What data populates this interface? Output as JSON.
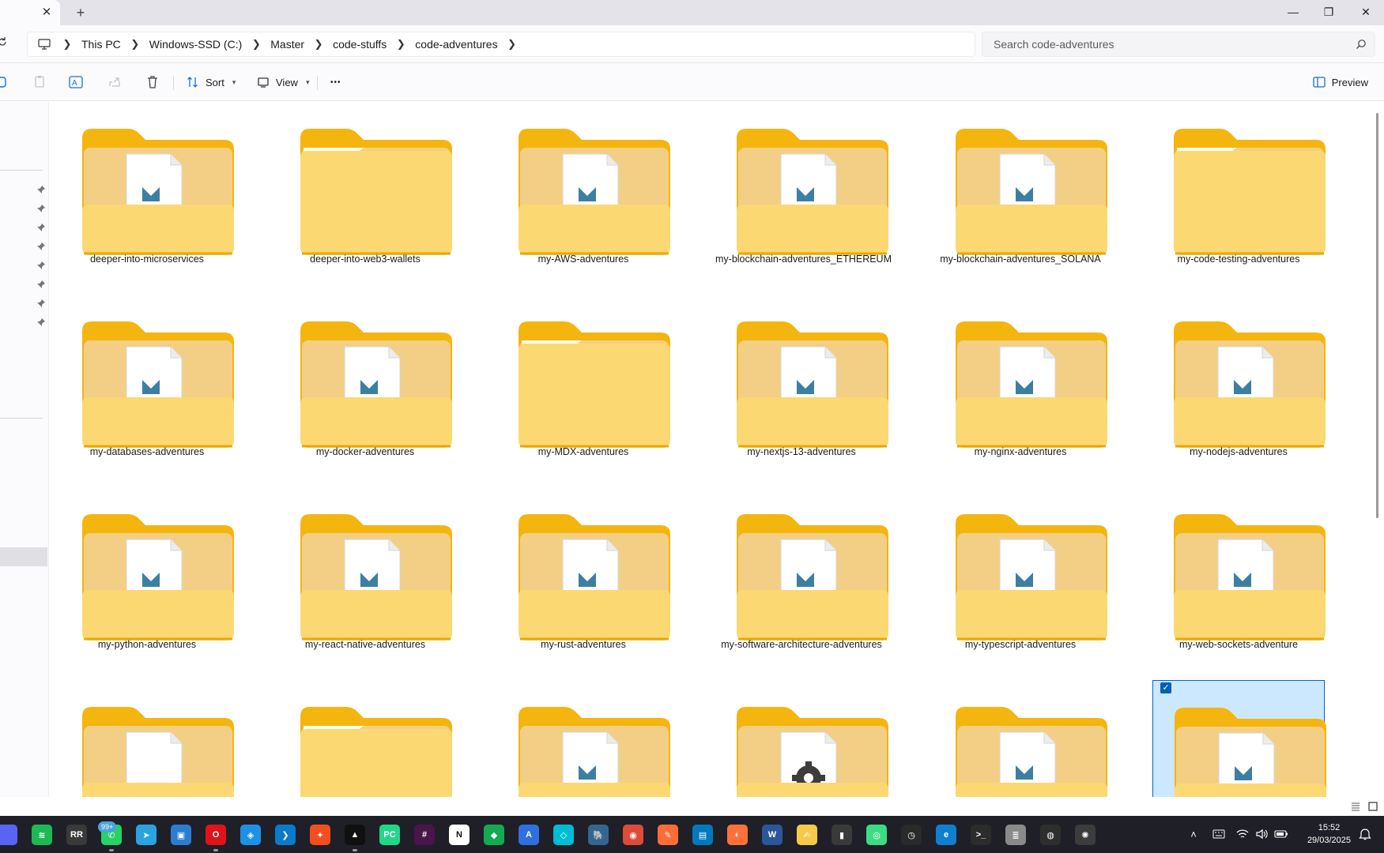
{
  "tabs": {
    "close_glyph": "✕",
    "new_tab_glyph": "+"
  },
  "window_controls": {
    "minimize": "—",
    "maximize": "❐",
    "close": "✕"
  },
  "breadcrumb": [
    "This PC",
    "Windows-SSD (C:)",
    "Master",
    "code-stuffs",
    "code-adventures"
  ],
  "search": {
    "placeholder": "Search code-adventures"
  },
  "toolbar": {
    "sort_label": "Sort",
    "view_label": "View",
    "more_glyph": "•••",
    "preview_label": "Preview",
    "icons": [
      "new-icon",
      "copy-icon",
      "rename-icon",
      "share-icon",
      "delete-icon"
    ]
  },
  "folders": [
    {
      "name": "deeper-into-microservices",
      "overlay": "markdown"
    },
    {
      "name": "deeper-into-web3-wallets",
      "overlay": "none"
    },
    {
      "name": "my-AWS-adventures",
      "overlay": "markdown"
    },
    {
      "name": "my-blockchain-adventures_ETHEREUM",
      "overlay": "markdown"
    },
    {
      "name": "my-blockchain-adventures_SOLANA",
      "overlay": "markdown"
    },
    {
      "name": "my-code-testing-adventures",
      "overlay": "none"
    },
    {
      "name": "my-databases-adventures",
      "overlay": "markdown"
    },
    {
      "name": "my-docker-adventures",
      "overlay": "markdown"
    },
    {
      "name": "my-MDX-adventures",
      "overlay": "none"
    },
    {
      "name": "my-nextjs-13-adventures",
      "overlay": "markdown"
    },
    {
      "name": "my-nginx-adventures",
      "overlay": "markdown"
    },
    {
      "name": "my-nodejs-adventures",
      "overlay": "markdown"
    },
    {
      "name": "my-python-adventures",
      "overlay": "markdown"
    },
    {
      "name": "my-react-native-adventures",
      "overlay": "markdown"
    },
    {
      "name": "my-rust-adventures",
      "overlay": "markdown"
    },
    {
      "name": "my-software-architecture-adventures",
      "overlay": "markdown"
    },
    {
      "name": "my-typescript-adventures",
      "overlay": "markdown"
    },
    {
      "name": "my-web-sockets-adventure",
      "overlay": "markdown"
    },
    {
      "name": "",
      "overlay": "document"
    },
    {
      "name": "",
      "overlay": "none"
    },
    {
      "name": "",
      "overlay": "markdown"
    },
    {
      "name": "",
      "overlay": "gear"
    },
    {
      "name": "",
      "overlay": "markdown"
    },
    {
      "name": "",
      "overlay": "markdown",
      "selected": true
    }
  ],
  "taskbar": {
    "apps": [
      {
        "name": "discord-icon",
        "color": "#5865f2",
        "glyph": ""
      },
      {
        "name": "spotify-icon",
        "color": "#1db954",
        "glyph": "≋"
      },
      {
        "name": "app-rr-icon",
        "color": "#3a3a3a",
        "glyph": "RR"
      },
      {
        "name": "whatsapp-icon",
        "color": "#25d366",
        "glyph": "✆"
      },
      {
        "name": "telegram-icon",
        "color": "#2aa3df",
        "glyph": "➤"
      },
      {
        "name": "remote-desktop-icon",
        "color": "#2b7cd3",
        "glyph": "▣"
      },
      {
        "name": "opera-icon",
        "color": "#e0131a",
        "glyph": "O"
      },
      {
        "name": "docker-icon",
        "color": "#1d91e6",
        "glyph": "◈"
      },
      {
        "name": "vscode-icon",
        "color": "#0a7acc",
        "glyph": "❯"
      },
      {
        "name": "figma-icon",
        "color": "#f24e1e",
        "glyph": "✦"
      },
      {
        "name": "cursor-icon",
        "color": "#101010",
        "glyph": "▲"
      },
      {
        "name": "pycharm-icon",
        "color": "#21d789",
        "glyph": "PC"
      },
      {
        "name": "slack-icon",
        "color": "#4a154b",
        "glyph": "#"
      },
      {
        "name": "notion-icon",
        "color": "#ffffff",
        "glyph": "N"
      },
      {
        "name": "mongodb-icon",
        "color": "#13aa52",
        "glyph": "◆"
      },
      {
        "name": "compass-icon",
        "color": "#2f6fdf",
        "glyph": "A"
      },
      {
        "name": "cube-icon",
        "color": "#00bcd4",
        "glyph": "◇"
      },
      {
        "name": "postgres-icon",
        "color": "#336791",
        "glyph": "🐘"
      },
      {
        "name": "chrome-icon",
        "color": "#dd4b39",
        "glyph": "◉"
      },
      {
        "name": "postman-icon",
        "color": "#ff6c37",
        "glyph": "✎"
      },
      {
        "name": "trello-icon",
        "color": "#0079bf",
        "glyph": "▤"
      },
      {
        "name": "firefox-icon",
        "color": "#ff7139",
        "glyph": "◐"
      },
      {
        "name": "word-icon",
        "color": "#2b579a",
        "glyph": "W"
      },
      {
        "name": "notes-icon",
        "color": "#f7c948",
        "glyph": "✍"
      },
      {
        "name": "terminal-app-icon",
        "color": "#3a3a3a",
        "glyph": "▮"
      },
      {
        "name": "android-icon",
        "color": "#3ddc84",
        "glyph": "◎"
      },
      {
        "name": "clock-app-icon",
        "color": "#2a2a2a",
        "glyph": "◷"
      },
      {
        "name": "edge-icon",
        "color": "#0f7fcf",
        "glyph": "e"
      },
      {
        "name": "cmd-icon",
        "color": "#2c2c2c",
        "glyph": ">_"
      },
      {
        "name": "database-icon",
        "color": "#8a8a8a",
        "glyph": "≣"
      },
      {
        "name": "obs-icon",
        "color": "#2e2e2e",
        "glyph": "◍"
      },
      {
        "name": "davinci-icon",
        "color": "#3c3c3c",
        "glyph": "✺"
      }
    ],
    "whatsapp_badge": "99+",
    "tray": [
      "chevron-up-icon",
      "keyboard-icon",
      "wifi-icon",
      "volume-icon",
      "battery-icon"
    ],
    "time": "15:52",
    "date": "29/03/2025"
  },
  "colors": {
    "folder_back": "#f5b50f",
    "folder_front": "#fcd872",
    "selection_bg": "#cce8ff",
    "selection_border": "#0064c8",
    "accent": "#005fb8"
  }
}
